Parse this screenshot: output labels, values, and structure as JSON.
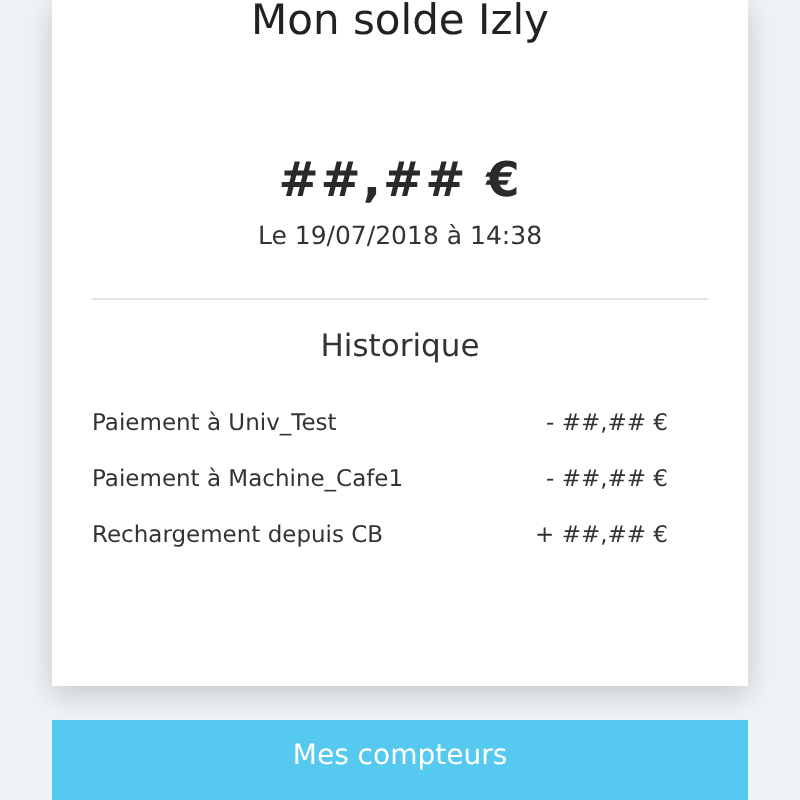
{
  "card": {
    "title": "Mon solde Izly",
    "balance": "##,## €",
    "date": "Le 19/07/2018 à 14:38",
    "history_title": "Historique",
    "history": [
      {
        "label": "Paiement à Univ_Test",
        "amount": "- ##,## €"
      },
      {
        "label": "Paiement à Machine_Cafe1",
        "amount": "- ##,## €"
      },
      {
        "label": "Rechargement depuis CB",
        "amount": "+ ##,## €"
      }
    ]
  },
  "button": {
    "label": "Mes compteurs"
  }
}
